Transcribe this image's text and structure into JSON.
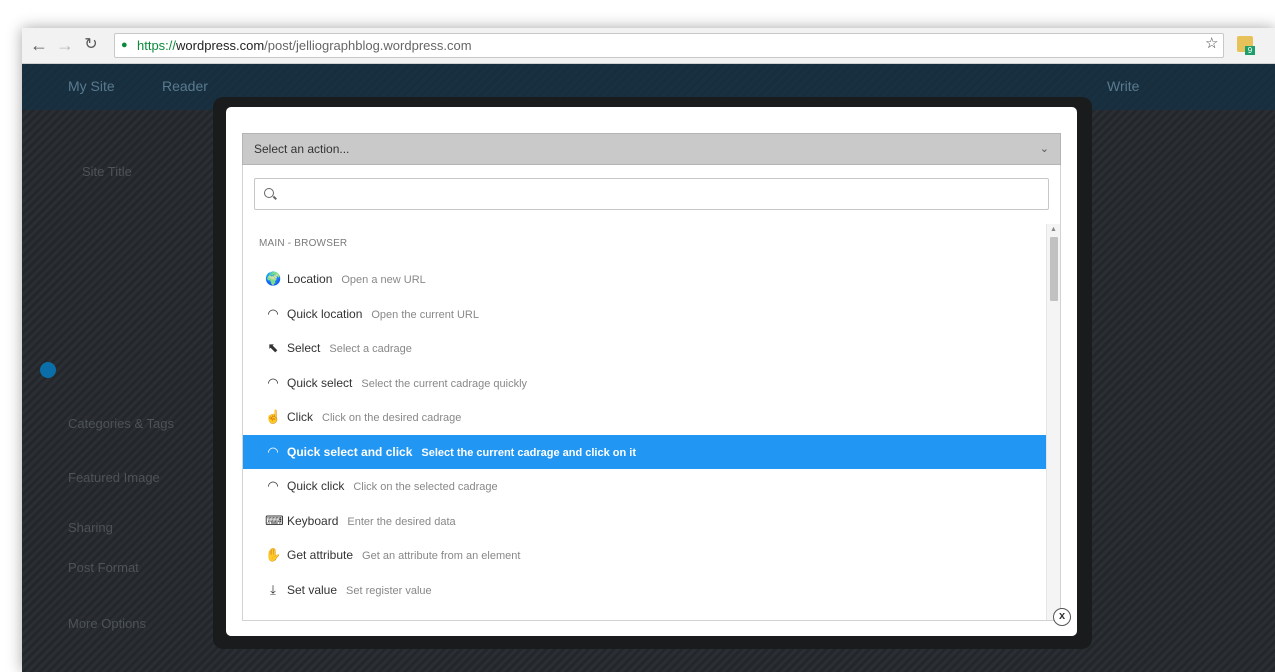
{
  "browser": {
    "url_scheme": "https://",
    "url_host": "wordpress.com",
    "url_path": "/post/jelliographblog.wordpress.com",
    "ext_badge": "9"
  },
  "wordpress": {
    "my_site": "My Site",
    "reader": "Reader",
    "write": "Write",
    "site_title": "Site Title",
    "categories": "Categories & Tags",
    "featured": "Featured Image",
    "sharing": "Sharing",
    "post_format": "Post Format",
    "more_options": "More Options"
  },
  "modal": {
    "select_placeholder": "Select an action...",
    "search_value": "",
    "group_label": "MAIN - BROWSER",
    "actions": [
      {
        "icon": "globe-icon",
        "glyph": "🌍",
        "name": "Location",
        "desc": "Open a new URL"
      },
      {
        "icon": "speedometer-icon",
        "glyph": "◠",
        "name": "Quick location",
        "desc": "Open the current URL"
      },
      {
        "icon": "cursor-select-icon",
        "glyph": "⬉",
        "name": "Select",
        "desc": "Select a cadrage"
      },
      {
        "icon": "speedometer-icon",
        "glyph": "◠",
        "name": "Quick select",
        "desc": "Select the current cadrage quickly"
      },
      {
        "icon": "hand-click-icon",
        "glyph": "☝",
        "name": "Click",
        "desc": "Click on the desired cadrage"
      },
      {
        "icon": "speedometer-icon",
        "glyph": "◠",
        "name": "Quick select and click",
        "desc": "Select the current cadrage and click on it",
        "active": true
      },
      {
        "icon": "speedometer-icon",
        "glyph": "◠",
        "name": "Quick click",
        "desc": "Click on the selected cadrage"
      },
      {
        "icon": "keyboard-icon",
        "glyph": "⌨",
        "name": "Keyboard",
        "desc": "Enter the desired data"
      },
      {
        "icon": "hand-grab-icon",
        "glyph": "✋",
        "name": "Get attribute",
        "desc": "Get an attribute from an element"
      },
      {
        "icon": "download-icon",
        "glyph": "⤓",
        "name": "Set value",
        "desc": "Set register value"
      }
    ],
    "close_label": "x"
  }
}
